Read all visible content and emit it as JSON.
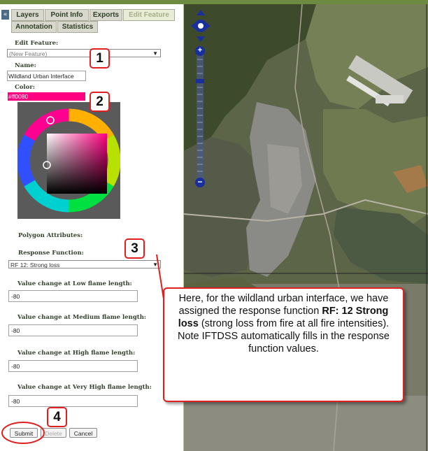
{
  "tabs": {
    "collapse_label": "«",
    "items": [
      {
        "label": "Layers"
      },
      {
        "label": "Point Info"
      },
      {
        "label": "Exports"
      },
      {
        "label": "Edit Feature"
      },
      {
        "label": "Annotation"
      },
      {
        "label": "Statistics"
      }
    ],
    "active": "Edit Feature"
  },
  "form": {
    "edit_feature_label": "Edit Feature:",
    "edit_feature_value": "(New Feature)",
    "name_label": "Name:",
    "name_value": "Wildland Urban Interface",
    "color_label": "Color:",
    "color_value": "#ff0080",
    "polygon_attributes_label": "Polygon Attributes:",
    "response_function_label": "Response Function:",
    "response_function_value": "RF 12: Strong loss",
    "low_label": "Value change at Low flame length:",
    "low_value": "-80",
    "medium_label": "Value change at Medium flame length:",
    "medium_value": "-80",
    "high_label": "Value change at High flame length:",
    "high_value": "-80",
    "very_high_label": "Value change at Very High flame length:",
    "very_high_value": "-80"
  },
  "buttons": {
    "submit": "Submit",
    "delete": "Delete",
    "cancel": "Cancel"
  },
  "steps": [
    "1",
    "2",
    "3",
    "4"
  ],
  "callout": {
    "line1": "Here, for the wildland urban interface, we have assigned the response function",
    "bold": "RF: 12 Strong loss",
    "line2": " (strong loss from fire at all fire intensities). Note IFTDSS automatically fills in the response function values."
  },
  "map_controls": {
    "zoom_in": "+",
    "zoom_out": "−"
  },
  "colors": {
    "accent_red": "#e02020",
    "selected_color": "#ff0080",
    "nav_blue": "#1a2f9e"
  }
}
